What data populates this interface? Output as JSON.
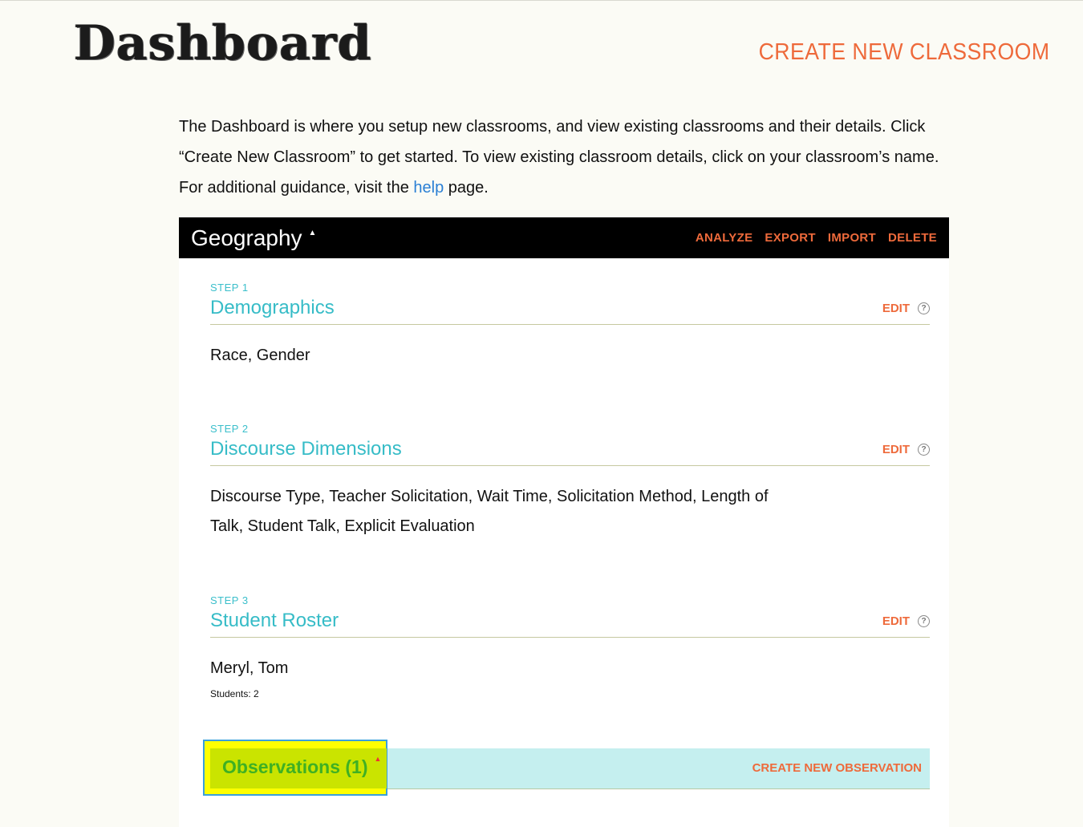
{
  "header": {
    "logo_text": "Dashboard",
    "create_classroom_label": "CREATE NEW CLASSROOM"
  },
  "intro": {
    "text_before_link": "The Dashboard is where you setup new classrooms, and view existing classrooms and their details. Click “Create New Classroom” to get started. To view existing classroom details, click on your classroom’s name. For additional guidance, visit the ",
    "link_text": "help",
    "text_after_link": " page."
  },
  "classroom": {
    "name": "Geography",
    "caret": "▲",
    "actions": [
      "ANALYZE",
      "EXPORT",
      "IMPORT",
      "DELETE"
    ],
    "steps": [
      {
        "label": "STEP 1",
        "title": "Demographics",
        "edit": "EDIT",
        "body": "Race, Gender"
      },
      {
        "label": "STEP 2",
        "title": "Discourse Dimensions",
        "edit": "EDIT",
        "body": "Discourse Type, Teacher Solicitation, Wait Time, Solicitation Method, Length of Talk, Student Talk, Explicit Evaluation"
      },
      {
        "label": "STEP 3",
        "title": "Student Roster",
        "edit": "EDIT",
        "body": "Meryl, Tom",
        "students_count": "Students: 2"
      }
    ],
    "observations": {
      "title": "Observations (1)",
      "caret": "▲",
      "create_label": "CREATE NEW OBSERVATION"
    }
  },
  "colors": {
    "accent_orange": "#ee6a3b",
    "step_teal": "#36bcc7",
    "observations_bar": "#c5efef",
    "highlight_yellow": "#ffff00",
    "highlight_border": "#3aa0dc",
    "link_blue": "#2a7fd4"
  },
  "icons": [
    "help-icon",
    "caret-up-icon"
  ]
}
